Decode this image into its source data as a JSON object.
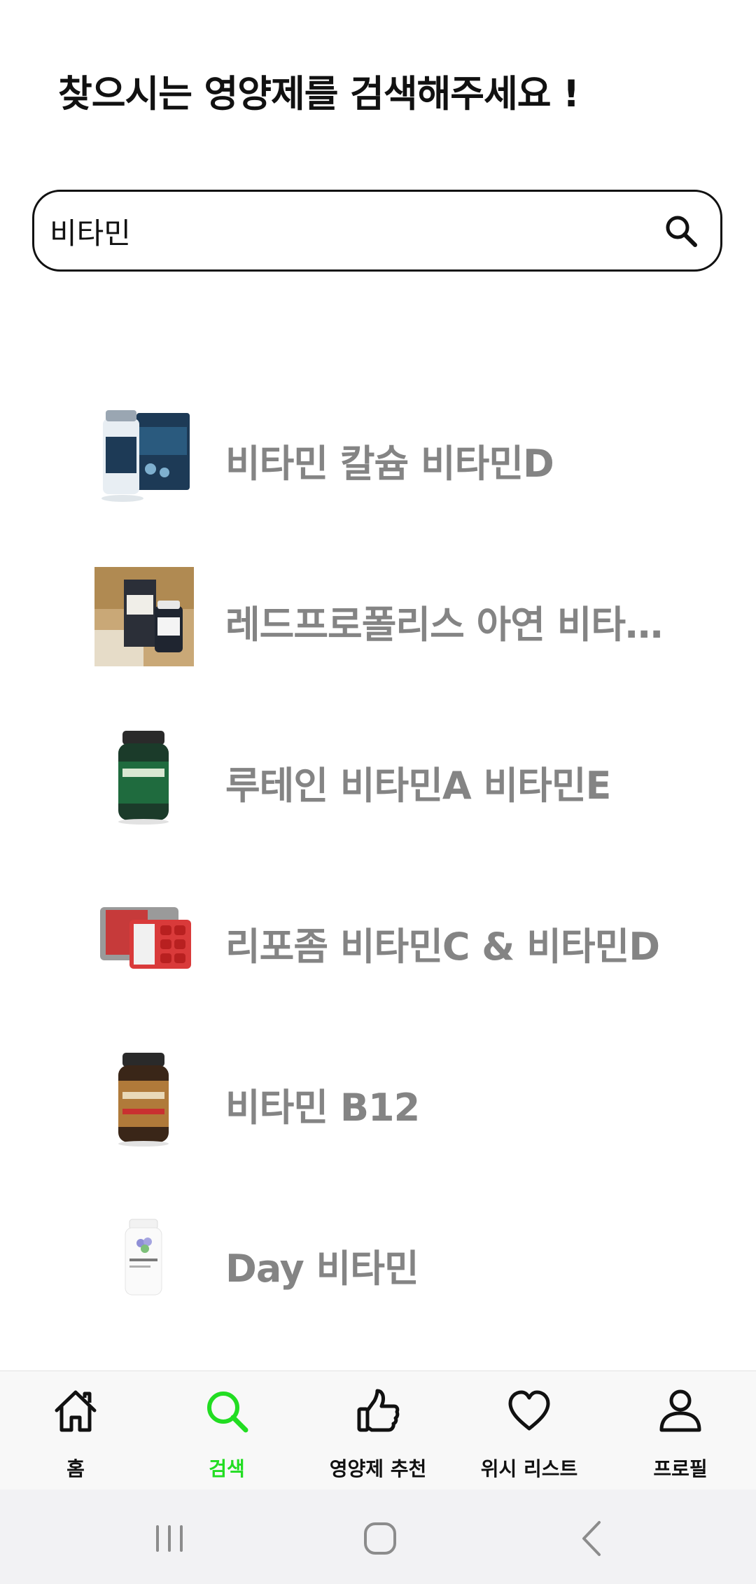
{
  "header": {
    "title": "찾으시는 영양제를 검색해주세요 !"
  },
  "search": {
    "value": "비타민",
    "icon": "search-icon"
  },
  "results": [
    {
      "name": "비타민 칼슘 비타민D",
      "thumb": "supplement-box-bottle"
    },
    {
      "name": "레드프로폴리스 아연 비타민...",
      "thumb": "propolis-product-photo"
    },
    {
      "name": "루테인 비타민A 비타민E",
      "thumb": "green-bottle"
    },
    {
      "name": "리포좀 비타민C & 비타민D",
      "thumb": "red-blister-pack"
    },
    {
      "name": "비타민 B12",
      "thumb": "brown-bottle"
    },
    {
      "name": "Day 비타민",
      "thumb": "white-bottle"
    }
  ],
  "bottom_nav": {
    "items": [
      {
        "label": "홈",
        "icon": "home-icon"
      },
      {
        "label": "검색",
        "icon": "search-icon",
        "active": true
      },
      {
        "label": "영양제 추천",
        "icon": "thumbs-up-icon"
      },
      {
        "label": "위시 리스트",
        "icon": "heart-icon"
      },
      {
        "label": "프로필",
        "icon": "person-icon"
      }
    ]
  },
  "colors": {
    "accent": "#22dd22",
    "result_text": "#848484",
    "text": "#111111"
  }
}
